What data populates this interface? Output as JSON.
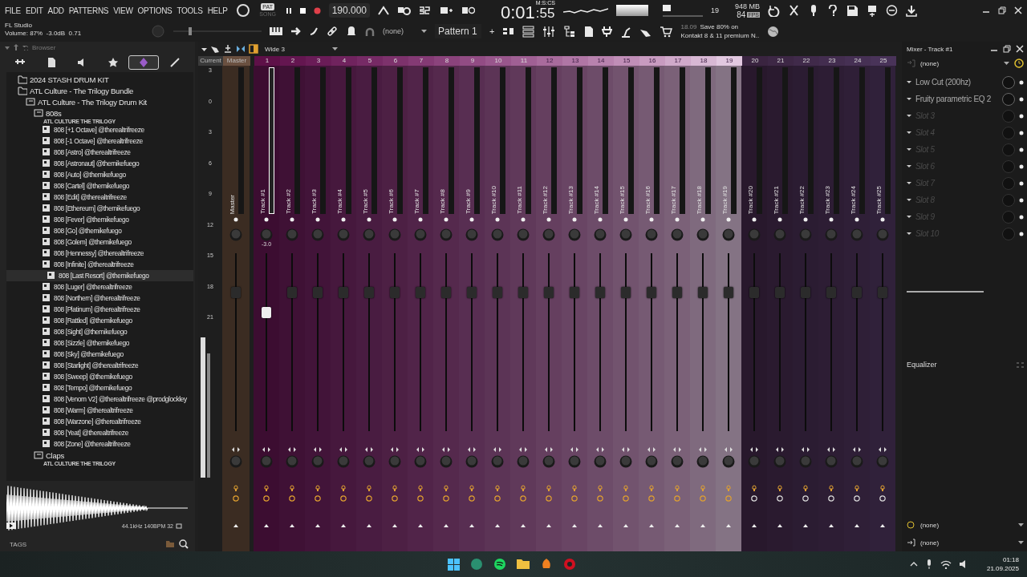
{
  "menu": [
    "FILE",
    "EDIT",
    "ADD",
    "PATTERNS",
    "VIEW",
    "OPTIONS",
    "TOOLS",
    "HELP"
  ],
  "hint": {
    "title": "FL Studio",
    "text": "Volume: 87%  -3.0dB  0.71"
  },
  "modes": [
    {
      "label": "PAT",
      "selected": true
    },
    {
      "label": "SONG",
      "selected": false
    }
  ],
  "tempo": "190.000",
  "master_pitch": {
    "level": 0.18
  },
  "time": {
    "value": "0:01",
    "centis": ":55",
    "unit": "M:S:CS"
  },
  "cpu": "19",
  "memory": "948 MB",
  "fps": "84",
  "fps_unit": "FPS",
  "pattern_source": "(none)",
  "pattern": "Pattern 1",
  "pattern_add": "+",
  "news": {
    "date": "18.09",
    "lines": [
      "Save 80% on",
      "Kontakt 8 & 11 premium N.."
    ]
  },
  "browser": {
    "title": "Browser",
    "tabs": [
      {
        "kind": "all",
        "selected": false
      },
      {
        "kind": "files",
        "selected": false
      },
      {
        "kind": "speaker",
        "selected": false
      },
      {
        "kind": "star",
        "selected": false
      },
      {
        "kind": "plugin",
        "selected": true
      },
      {
        "kind": "guitar",
        "selected": false
      }
    ],
    "tree": [
      {
        "kind": "folder",
        "name": "2024 STASH DRUM KIT"
      },
      {
        "kind": "folder",
        "name": "ATL Culture - The Trilogy Bundle",
        "children": [
          {
            "kind": "pack",
            "name": "ATL Culture - The Trilogy Drum Kit",
            "children": [
              {
                "kind": "pack",
                "name": "808s",
                "caption": "ATL CULTURE THE TRILOGY",
                "children": [
                  {
                    "kind": "file",
                    "name": "808 [+1 Octave] @therealtrifreeze",
                    "selected": false
                  },
                  {
                    "kind": "file",
                    "name": "808 [-1 Octave] @therealtrifreeze",
                    "selected": false
                  },
                  {
                    "kind": "file",
                    "name": "808 [Astro] @therealtrifreeze",
                    "selected": false
                  },
                  {
                    "kind": "file",
                    "name": "808 [Astronaut] @themikefuego",
                    "selected": false
                  },
                  {
                    "kind": "file",
                    "name": "808 [Auto] @themikefuego",
                    "selected": false
                  },
                  {
                    "kind": "file",
                    "name": "808 [Cartel] @themikefuego",
                    "selected": false
                  },
                  {
                    "kind": "file",
                    "name": "808 [Edit] @therealtrifreeze",
                    "selected": false
                  },
                  {
                    "kind": "file",
                    "name": "808 [Ethereum] @themikefuego",
                    "selected": false
                  },
                  {
                    "kind": "file",
                    "name": "808 [Fever] @themikefuego",
                    "selected": false
                  },
                  {
                    "kind": "file",
                    "name": "808 [Go] @themikefuego",
                    "selected": false
                  },
                  {
                    "kind": "file",
                    "name": "808 [Golem] @themikefuego",
                    "selected": false
                  },
                  {
                    "kind": "file",
                    "name": "808 [Hennessy] @therealtrifreeze",
                    "selected": false
                  },
                  {
                    "kind": "file",
                    "name": "808 [Infinite] @therealtrifreeze",
                    "selected": false
                  },
                  {
                    "kind": "file",
                    "name": "808 [Last Resort] @themikefuego",
                    "selected": true
                  },
                  {
                    "kind": "file",
                    "name": "808 [Luger] @therealtrifreeze",
                    "selected": false
                  },
                  {
                    "kind": "file",
                    "name": "808 [Northern] @therealtrifreeze",
                    "selected": false
                  },
                  {
                    "kind": "file",
                    "name": "808 [Platinum] @therealtrifreeze",
                    "selected": false
                  },
                  {
                    "kind": "file",
                    "name": "808 [Rattled] @themikefuego",
                    "selected": false
                  },
                  {
                    "kind": "file",
                    "name": "808 [Sight] @themikefuego",
                    "selected": false
                  },
                  {
                    "kind": "file",
                    "name": "808 [Sizzle] @themikefuego",
                    "selected": false
                  },
                  {
                    "kind": "file",
                    "name": "808 [Sky] @themikefuego",
                    "selected": false
                  },
                  {
                    "kind": "file",
                    "name": "808 [Starlight] @therealtrifreeze",
                    "selected": false
                  },
                  {
                    "kind": "file",
                    "name": "808 [Sweep] @themikefuego",
                    "selected": false
                  },
                  {
                    "kind": "file",
                    "name": "808 [Tempo] @themikefuego",
                    "selected": false
                  },
                  {
                    "kind": "file",
                    "name": "808 [Venom V2] @therealtrifreeze @prodglockley",
                    "selected": false
                  },
                  {
                    "kind": "file",
                    "name": "808 [Warm] @therealtrifreeze",
                    "selected": false
                  },
                  {
                    "kind": "file",
                    "name": "808 [Warzone] @therealtrifreeze",
                    "selected": false
                  },
                  {
                    "kind": "file",
                    "name": "808 [Yeat] @therealtrifreeze",
                    "selected": false
                  },
                  {
                    "kind": "file",
                    "name": "808 [Zone] @therealtrifreeze",
                    "selected": false
                  }
                ]
              },
              {
                "kind": "pack",
                "name": "Claps",
                "caption": "ATL CULTURE THE TRILOGY"
              }
            ]
          }
        ]
      }
    ],
    "sample_info": "44.1kHz 140BPM 32",
    "tags": "TAGS"
  },
  "mixer": {
    "preset": "Wide 3",
    "current": "Current",
    "master_header": "Master",
    "scale": [
      "3",
      "0",
      "3",
      "6",
      "9",
      "12",
      "15",
      "18",
      "21"
    ],
    "master": {
      "name": "Master",
      "level": 0.8
    },
    "tracks": [
      {
        "number": "1",
        "name": "Track #1",
        "color": "#5e1048",
        "selected": true,
        "level": 0.68,
        "readout": "-3.0"
      },
      {
        "number": "2",
        "name": "Track #2",
        "color": "#641650",
        "selected": false,
        "level": 0.8
      },
      {
        "number": "3",
        "name": "Track #3",
        "color": "#6a1c57",
        "selected": false,
        "level": 0.8
      },
      {
        "number": "4",
        "name": "Track #4",
        "color": "#70235e",
        "selected": false,
        "level": 0.8
      },
      {
        "number": "5",
        "name": "Track #5",
        "color": "#762a65",
        "selected": false,
        "level": 0.8
      },
      {
        "number": "6",
        "name": "Track #6",
        "color": "#7d326c",
        "selected": false,
        "level": 0.8
      },
      {
        "number": "7",
        "name": "Track #7",
        "color": "#843a74",
        "selected": false,
        "level": 0.8
      },
      {
        "number": "8",
        "name": "Track #8",
        "color": "#8b437c",
        "selected": false,
        "level": 0.8
      },
      {
        "number": "9",
        "name": "Track #9",
        "color": "#924c84",
        "selected": false,
        "level": 0.8
      },
      {
        "number": "10",
        "name": "Track #10",
        "color": "#99568c",
        "selected": false,
        "level": 0.8
      },
      {
        "number": "11",
        "name": "Track #11",
        "color": "#a06094",
        "selected": false,
        "level": 0.8
      },
      {
        "number": "12",
        "name": "Track #12",
        "color": "#a86b9c",
        "selected": false,
        "level": 0.8
      },
      {
        "number": "13",
        "name": "Track #13",
        "color": "#b076a5",
        "selected": false,
        "level": 0.8
      },
      {
        "number": "14",
        "name": "Track #14",
        "color": "#b882ae",
        "selected": false,
        "level": 0.8
      },
      {
        "number": "15",
        "name": "Track #15",
        "color": "#c08eb7",
        "selected": false,
        "level": 0.8
      },
      {
        "number": "16",
        "name": "Track #16",
        "color": "#c89bc0",
        "selected": false,
        "level": 0.8
      },
      {
        "number": "17",
        "name": "Track #17",
        "color": "#d0a9ca",
        "selected": false,
        "level": 0.8
      },
      {
        "number": "18",
        "name": "Track #18",
        "color": "#d8b8d4",
        "selected": false,
        "level": 0.8
      },
      {
        "number": "19",
        "name": "Track #19",
        "color": "#e2c8e0",
        "selected": false,
        "level": 0.8
      },
      {
        "number": "20",
        "name": "Track #20",
        "color": "#3a2440",
        "selected": false,
        "level": 0.8
      },
      {
        "number": "21",
        "name": "Track #21",
        "color": "#3d2745",
        "selected": false,
        "level": 0.8
      },
      {
        "number": "22",
        "name": "Track #22",
        "color": "#402a4a",
        "selected": false,
        "level": 0.8
      },
      {
        "number": "23",
        "name": "Track #23",
        "color": "#432d4f",
        "selected": false,
        "level": 0.8
      },
      {
        "number": "24",
        "name": "Track #24",
        "color": "#463054",
        "selected": false,
        "level": 0.8
      },
      {
        "number": "25",
        "name": "Track #25",
        "color": "#493359",
        "selected": false,
        "level": 0.8
      }
    ]
  },
  "fx": {
    "title": "Mixer - Track #1",
    "input": "(none)",
    "slots": [
      {
        "name": "Low Cut (200hz)",
        "kind": "effect"
      },
      {
        "name": "Fruity parametric EQ 2",
        "kind": "effect"
      },
      {
        "name": "Slot 3",
        "kind": "empty"
      },
      {
        "name": "Slot 4",
        "kind": "empty"
      },
      {
        "name": "Slot 5",
        "kind": "empty"
      },
      {
        "name": "Slot 6",
        "kind": "empty"
      },
      {
        "name": "Slot 7",
        "kind": "empty"
      },
      {
        "name": "Slot 8",
        "kind": "empty"
      },
      {
        "name": "Slot 9",
        "kind": "empty"
      },
      {
        "name": "Slot 10",
        "kind": "empty"
      }
    ],
    "equalizer": "Equalizer",
    "routing": [
      "(none)",
      "(none)"
    ]
  },
  "taskbar": {
    "time": "01:18",
    "date": "21.09.2025"
  }
}
